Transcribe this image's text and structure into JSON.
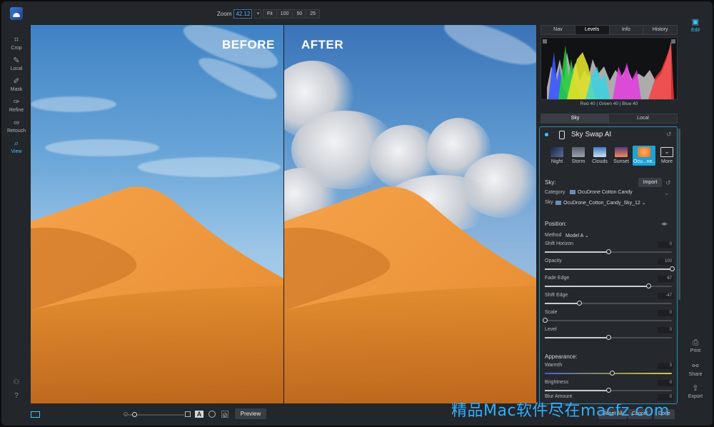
{
  "topbar": {
    "zoom_label": "Zoom",
    "zoom_value": "42.12",
    "zoom_presets": [
      "Fit",
      "100",
      "50",
      "25"
    ]
  },
  "left_tools": [
    {
      "label": "Crop",
      "icon": "crop-icon"
    },
    {
      "label": "Local",
      "icon": "local-brush-icon"
    },
    {
      "label": "Mask",
      "icon": "mask-brush-icon"
    },
    {
      "label": "Refine",
      "icon": "refine-brush-icon"
    },
    {
      "label": "Retouch",
      "icon": "retouch-icon"
    },
    {
      "label": "View",
      "icon": "view-zoom-icon",
      "active": true
    }
  ],
  "photo": {
    "before_label": "BEFORE",
    "after_label": "AFTER"
  },
  "right_panel": {
    "top_tabs": [
      "Nav",
      "Levels",
      "Info",
      "History"
    ],
    "active_top_tab": "Levels",
    "histogram_readout": "Red  40  | Green  40  | Blue  40",
    "mode_tabs": [
      "Sky",
      "Local"
    ],
    "active_mode_tab": "Sky"
  },
  "module": {
    "title": "Sky Swap AI",
    "presets": [
      {
        "label": "Night",
        "color": "#3b4a6b"
      },
      {
        "label": "Storm",
        "color": "#6e7682"
      },
      {
        "label": "Clouds",
        "color": "#7aa6d8"
      },
      {
        "label": "Sunset",
        "color": "#d87a62"
      },
      {
        "label": "Ocu...ne...",
        "color": "#f08a2a",
        "selected": true
      },
      {
        "label": "More",
        "color": "#25282d"
      }
    ],
    "sky_label": "Sky:",
    "import_label": "Import",
    "category_label": "Category",
    "category_value": "OcuDrone Cotton Candy",
    "sky_field_label": "Sky",
    "sky_value": "OcuDrone_Cotton_Candy_Sky_12",
    "position_label": "Position:",
    "method_label": "Method",
    "method_value": "Model A",
    "sliders": [
      {
        "label": "Shift Horizon",
        "value": "0",
        "fraction": 0.5
      },
      {
        "label": "Opacity",
        "value": "100",
        "fraction": 1.0
      },
      {
        "label": "Fade Edge",
        "value": "67",
        "fraction": 0.82
      },
      {
        "label": "Shift Edge",
        "value": "-47",
        "fraction": 0.27
      },
      {
        "label": "Scale",
        "value": "0",
        "fraction": 0.0
      },
      {
        "label": "Level",
        "value": "0",
        "fraction": 0.5
      }
    ],
    "appearance_label": "Appearance:",
    "appearance_sliders": [
      {
        "label": "Warmth",
        "value": "3",
        "fraction": 0.53
      },
      {
        "label": "Brightness",
        "value": "0",
        "fraction": 0.5
      },
      {
        "label": "Blur Amount",
        "value": "0",
        "fraction": 0.0
      }
    ]
  },
  "far_right": {
    "edit_label": "Edit",
    "print_label": "Print",
    "share_label": "Share",
    "export_label": "Export"
  },
  "bottombar": {
    "preview_label": "Preview",
    "reset_all_label": "Reset All",
    "cancel_label": "Cancel",
    "done_label": "Done"
  },
  "watermark": "精品Mac软件尽在macfz.com"
}
